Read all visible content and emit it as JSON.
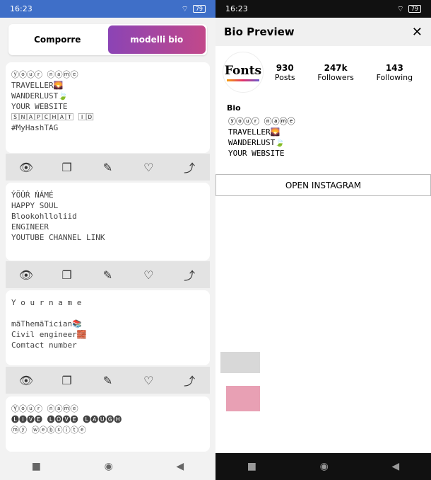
{
  "left": {
    "status": {
      "time": "16:23",
      "battery": "79"
    },
    "tabs": {
      "compose": "Comporre",
      "bio_templates": "modelli bio"
    },
    "cards": [
      {
        "text": "ⓨⓞⓤⓡ ⓝⓐⓜⓔ\nTRAVELLER🌄\nWANDERLUST🍃\nYOUR WEBSITE\n🅂🄽🄰🄿🄲🄷🄰🅃 🄸🄳\n#MyHashTAG"
      },
      {
        "text": "ÝÖÛŔ ŃÁMÉ\nHAPPY SOUL\nBlookohlloliid\nENGINEER\nYOUTUBE CHANNEL LINK"
      },
      {
        "text": "Y o u r  n a m e\n\nmãThemãTician📚\nCivil engineer🧱\nComtact number"
      },
      {
        "text": "Ⓨⓞⓤⓡ ⓝⓐⓜⓔ\n🅛🅘🅥🅔 🅛🅞🅥🅔 🅛🅐🅤🅖🅗\nⓜⓨ ⓦⓔⓑⓢⓘⓣⓔ"
      }
    ],
    "icons": {
      "view": "👁",
      "copy": "❐",
      "edit": "✎",
      "like": "♡",
      "share": "⤴"
    }
  },
  "right": {
    "status": {
      "time": "16:23",
      "battery": "79"
    },
    "header": {
      "title": "Bio Preview",
      "close": "✕"
    },
    "logo_text": "Fonts",
    "stats": [
      {
        "value": "930",
        "label": "Posts"
      },
      {
        "value": "247k",
        "label": "Followers"
      },
      {
        "value": "143",
        "label": "Following"
      }
    ],
    "bio_title": "Bio",
    "bio_text": "ⓨⓞⓤⓡ ⓝⓐⓜⓔ\nTRAVELLER🌄\nWANDERLUST🍃\nYOUR WEBSITE",
    "open_button": "OPEN INSTAGRAM"
  },
  "nav": {
    "square": "■",
    "home": "◉",
    "back": "◀"
  }
}
